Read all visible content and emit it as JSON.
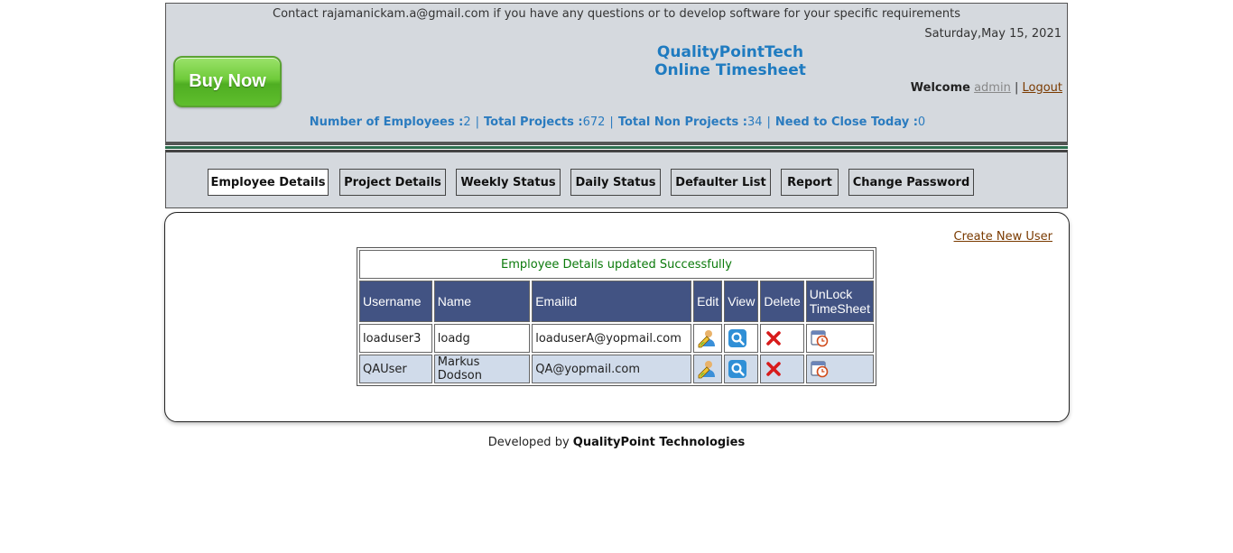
{
  "header": {
    "contact": "Contact rajamanickam.a@gmail.com if you have any questions or to develop software for your specific requirements",
    "date": "Saturday,May 15, 2021",
    "buy_now": "Buy Now",
    "brand_line1": "QualityPointTech",
    "brand_line2": "Online Timesheet",
    "welcome_label": "Welcome",
    "user": "admin",
    "logout": "Logout",
    "stats": {
      "employees_label": "Number of Employees :",
      "employees_value": "2",
      "projects_label": "Total Projects :",
      "projects_value": "672",
      "non_projects_label": "Total Non Projects :",
      "non_projects_value": "34",
      "close_today_label": "Need to Close Today :",
      "close_today_value": "0"
    }
  },
  "nav": {
    "tabs": [
      {
        "label": "Employee Details",
        "active": true
      },
      {
        "label": "Project Details",
        "active": false
      },
      {
        "label": "Weekly Status",
        "active": false
      },
      {
        "label": "Daily Status",
        "active": false
      },
      {
        "label": "Defaulter List",
        "active": false
      },
      {
        "label": "Report",
        "active": false
      },
      {
        "label": "Change Password",
        "active": false
      }
    ]
  },
  "main": {
    "create_user": "Create New User",
    "message": "Employee Details updated Successfully",
    "columns": [
      "Username",
      "Name",
      "Emailid",
      "Edit",
      "View",
      "Delete",
      "UnLock TimeSheet"
    ],
    "rows": [
      {
        "username": "loaduser3",
        "name": "loadg",
        "email": "loaduserA@yopmail.com"
      },
      {
        "username": "QAUser",
        "name": "Markus Dodson",
        "email": "QA@yopmail.com"
      }
    ],
    "icons": {
      "edit": "edit-user-icon",
      "view": "magnifier-view-icon",
      "delete": "red-x-delete-icon",
      "unlock": "calendar-clock-icon"
    }
  },
  "footer": {
    "prefix": "Developed by",
    "company": "QualityPoint Technologies"
  },
  "colors": {
    "header_bg": "#d5d9de",
    "brand": "#1f7bc0",
    "table_header": "#425383",
    "row_alt": "#d0dbea",
    "success": "#0b7a0b",
    "link": "#7a3a00"
  }
}
